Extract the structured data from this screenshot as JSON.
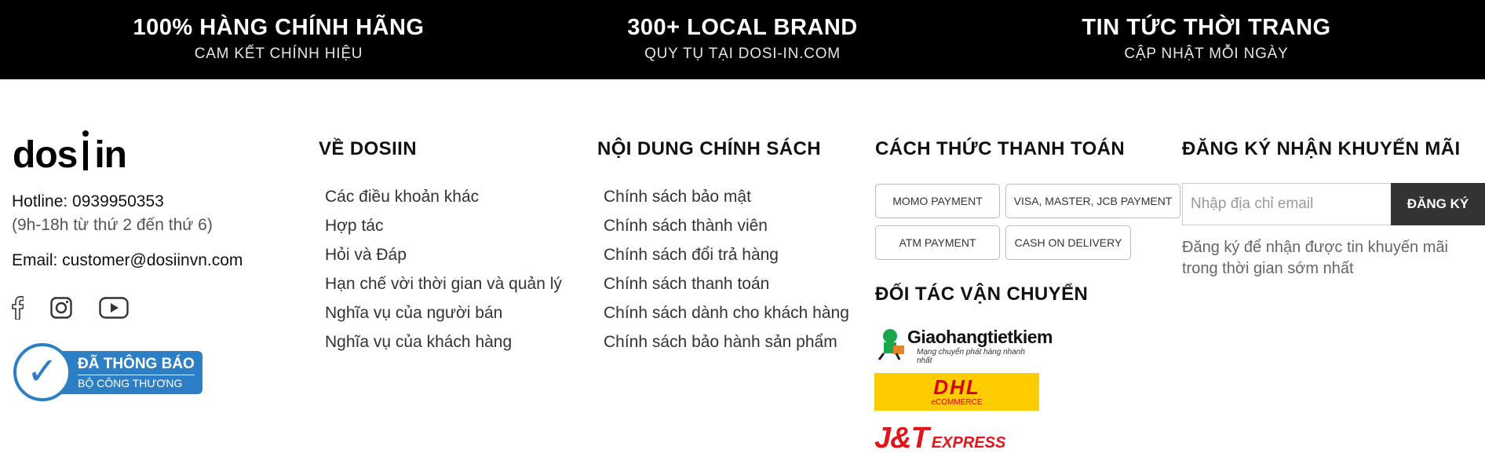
{
  "features": [
    {
      "title": "100% HÀNG CHÍNH HÃNG",
      "subtitle": "CAM KẾT CHÍNH HIỆU"
    },
    {
      "title": "300+ LOCAL BRAND",
      "subtitle": "QUY TỤ TẠI DOSI-IN.COM"
    },
    {
      "title": "TIN TỨC THỜI TRANG",
      "subtitle": "CẬP NHẬT MỖI NGÀY"
    }
  ],
  "brand": {
    "logo_left": "dos",
    "logo_right": "in",
    "hotline": "Hotline: 0939950353",
    "hours": "(9h-18h từ thứ 2 đến thứ 6)",
    "email": "Email: customer@dosiinvn.com",
    "social_icons": [
      "facebook-icon",
      "instagram-icon",
      "youtube-icon"
    ],
    "badge_line1": "ĐÃ THÔNG BÁO",
    "badge_line2": "BỘ CÔNG THƯƠNG"
  },
  "about": {
    "heading": "VỀ DOSIIN",
    "links": [
      "Các điều khoản khác",
      "Hợp tác",
      "Hỏi và Đáp",
      "Hạn chế vời thời gian và quản lý",
      "Nghĩa vụ của người bán",
      "Nghĩa vụ của khách hàng"
    ]
  },
  "policy": {
    "heading": "NỘI DUNG CHÍNH SÁCH",
    "links": [
      "Chính sách bảo mật",
      "Chính sách thành viên",
      "Chính sách đổi trả hàng",
      "Chính sách thanh toán",
      "Chính sách dành cho khách hàng",
      "Chính sách bảo hành sản phẩm"
    ]
  },
  "payment": {
    "heading": "CÁCH THỨC THANH TOÁN",
    "methods": [
      "MOMO PAYMENT",
      "VISA, MASTER, JCB PAYMENT",
      "ATM PAYMENT",
      "CASH ON DELIVERY"
    ],
    "shipping_heading": "ĐỐI TÁC VẬN CHUYỂN",
    "ghtk_name": "Giaohangtietkiem",
    "ghtk_tagline": "Mạng chuyển phát hàng nhanh nhất",
    "dhl_name": "DHL",
    "dhl_sub": "eCOMMERCE",
    "jt_name": "J&T",
    "jt_sub": "EXPRESS"
  },
  "newsletter": {
    "heading": "ĐĂNG KÝ NHẬN KHUYẾN MÃI",
    "placeholder": "Nhập địa chỉ email",
    "button": "ĐĂNG KÝ",
    "note": "Đăng ký để nhận được tin khuyến mãi trong thời gian sớm nhất"
  },
  "colors": {
    "topbar": "#000000",
    "badge": "#2c7fc4",
    "dhl": "#ffcc00",
    "jt": "#e4141b",
    "button": "#333333"
  }
}
